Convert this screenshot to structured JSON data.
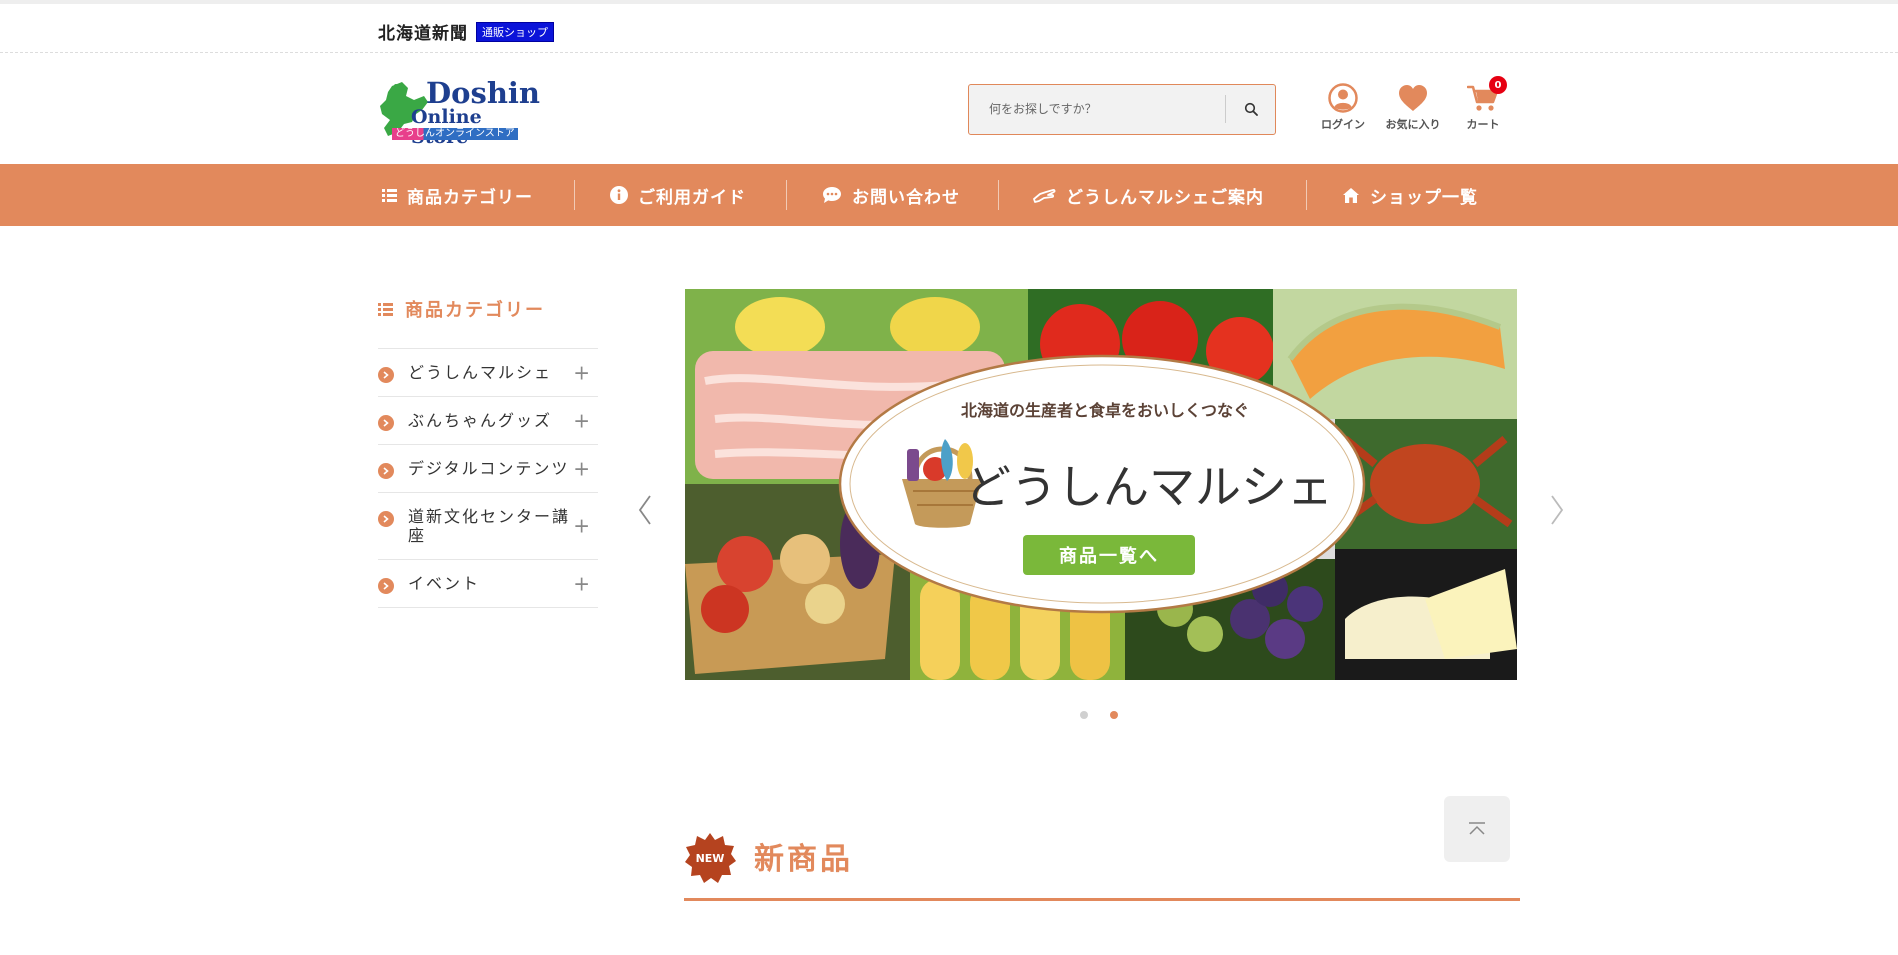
{
  "topbar": {
    "paper_name": "北海道新聞",
    "shop_badge": "通販ショップ"
  },
  "logo": {
    "title": "Doshin",
    "subtitle": "Online Store",
    "kana": "どうしんオンラインストア"
  },
  "search": {
    "placeholder": "何をお探しですか？"
  },
  "header_icons": {
    "login": "ログイン",
    "favorites": "お気に入り",
    "cart": "カート",
    "cart_count": "0"
  },
  "nav": [
    {
      "label": "商品カテゴリー",
      "icon": "list-icon"
    },
    {
      "label": "ご利用ガイド",
      "icon": "info-icon"
    },
    {
      "label": "お問い合わせ",
      "icon": "chat-icon"
    },
    {
      "label": "どうしんマルシェご案内",
      "icon": "hand-icon"
    },
    {
      "label": "ショップ一覧",
      "icon": "home-icon"
    }
  ],
  "sidebar": {
    "title": "商品カテゴリー",
    "categories": [
      {
        "label": "どうしんマルシェ"
      },
      {
        "label": "ぶんちゃんグッズ"
      },
      {
        "label": "デジタルコンテンツ"
      },
      {
        "label": "道新文化センター講座"
      },
      {
        "label": "イベント"
      }
    ]
  },
  "banner": {
    "tagline": "北海道の生産者と食卓をおいしくつなぐ",
    "title": "どうしんマルシェ",
    "button": "商品一覧へ"
  },
  "slider": {
    "slide_count": 2,
    "active_slide": 2
  },
  "new_products": {
    "badge": "NEW",
    "title": "新商品"
  },
  "colors": {
    "accent": "#e2895c",
    "nav_bg": "#e2895c",
    "badge_blue": "#0b14d9",
    "cart_badge": "#e60012",
    "new_badge": "#b5431f",
    "banner_button": "#7ab83a"
  }
}
